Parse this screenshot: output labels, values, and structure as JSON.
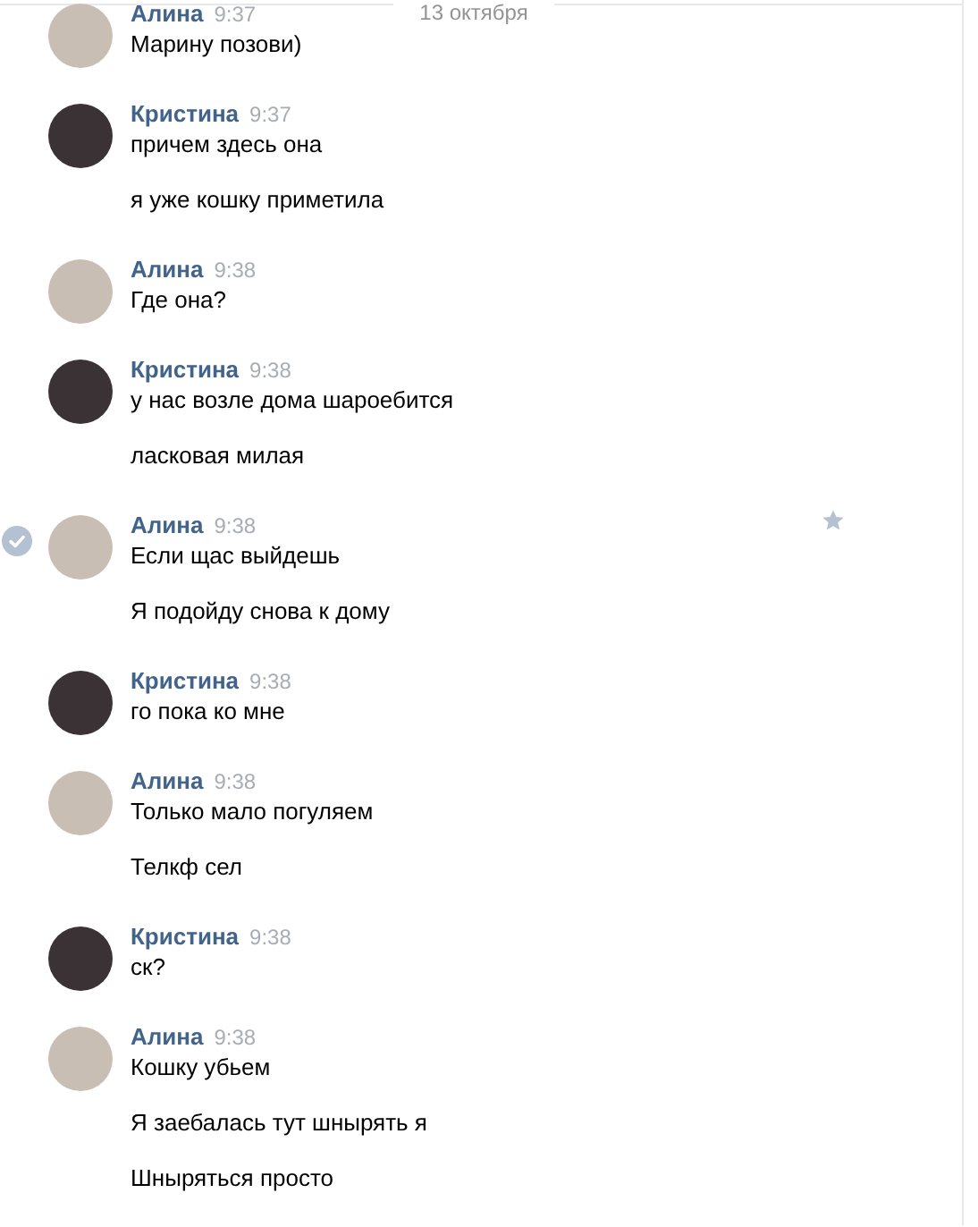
{
  "date_divider": "13 октября",
  "groups": [
    {
      "author": "Алина",
      "time": "9:37",
      "selected": false,
      "messages": [
        "Марину позови)"
      ]
    },
    {
      "author": "Кристина",
      "time": "9:37",
      "selected": false,
      "messages": [
        "причем здесь она",
        "я уже кошку приметила"
      ]
    },
    {
      "author": "Алина",
      "time": "9:38",
      "selected": false,
      "messages": [
        "Где она?"
      ]
    },
    {
      "author": "Кристина",
      "time": "9:38",
      "selected": false,
      "messages": [
        "у нас возле дома шароебится",
        "ласковая милая"
      ]
    },
    {
      "author": "Алина",
      "time": "9:38",
      "selected": true,
      "messages": [
        "Если щас выйдешь",
        "Я подойду снова к дому"
      ]
    },
    {
      "author": "Кристина",
      "time": "9:38",
      "selected": false,
      "messages": [
        "го пока ко мне"
      ]
    },
    {
      "author": "Алина",
      "time": "9:38",
      "selected": false,
      "messages": [
        "Только мало погуляем",
        "Телкф сел"
      ]
    },
    {
      "author": "Кристина",
      "time": "9:38",
      "selected": false,
      "messages": [
        "ск?"
      ]
    },
    {
      "author": "Алина",
      "time": "9:38",
      "selected": false,
      "messages": [
        "Кошку убьем",
        "Я заебалась тут шнырять я",
        "Шныряться просто"
      ]
    }
  ]
}
